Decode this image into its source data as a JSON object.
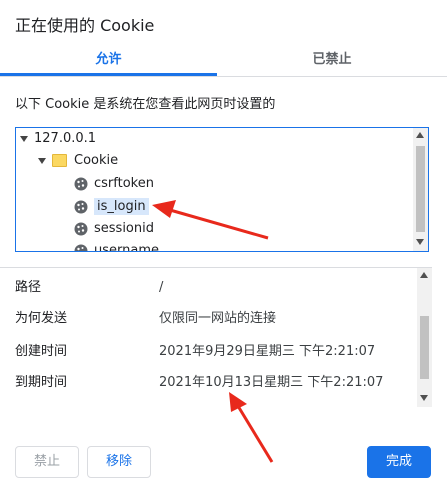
{
  "dialog": {
    "title": "正在使用的 Cookie"
  },
  "tabs": [
    {
      "label": "允许",
      "active": true
    },
    {
      "label": "已禁止",
      "active": false
    }
  ],
  "description": "以下 Cookie 是系统在您查看此网页时设置的",
  "tree": {
    "host": "127.0.0.1",
    "folder": "Cookie",
    "cookies": [
      "csrftoken",
      "is_login",
      "sessionid",
      "username"
    ],
    "selected": "is_login"
  },
  "details": [
    {
      "label": "路径",
      "value": "/"
    },
    {
      "label": "为何发送",
      "value": "仅限同一网站的连接"
    },
    {
      "label": "创建时间",
      "value": "2021年9月29日星期三 下午2:21:07"
    },
    {
      "label": "到期时间",
      "value": "2021年10月13日星期三 下午2:21:07"
    }
  ],
  "buttons": {
    "block": "禁止",
    "remove": "移除",
    "done": "完成"
  },
  "colors": {
    "accent": "#1a73e8",
    "annotation": "#e8291c"
  }
}
